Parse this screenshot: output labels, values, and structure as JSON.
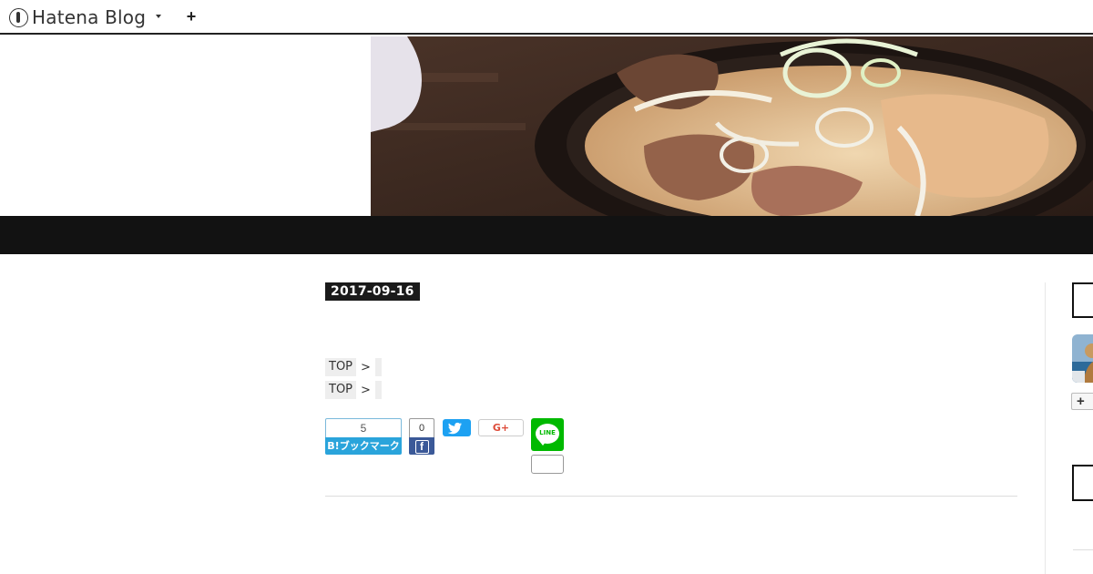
{
  "topbar": {
    "logo_text": "Hatena Blog",
    "logo_icon": "hatena-pen-icon",
    "menu_icon": "caret-down-icon",
    "add_icon": "plus-icon",
    "add_label": "+"
  },
  "header": {
    "banner_image": "food-photo-banner",
    "nav_color": "#121212"
  },
  "entry": {
    "date": "2017-09-16",
    "breadcrumbs": [
      {
        "top_label": "TOP",
        "separator": ">"
      },
      {
        "top_label": "TOP",
        "separator": ">"
      }
    ]
  },
  "share": {
    "hatena_count": "5",
    "hatena_label": "B!ブックマーク",
    "facebook_count": "0",
    "facebook_icon": "facebook-icon",
    "twitter_icon": "twitter-bird-icon",
    "googleplus_label": "G+",
    "line_label": "LINE",
    "colors": {
      "hatena": "#2aa4db",
      "facebook": "#3b5998",
      "twitter": "#1da1f2",
      "googleplus": "#dd4b39",
      "line": "#00b900"
    }
  },
  "sidebar": {
    "add_label": "+"
  }
}
